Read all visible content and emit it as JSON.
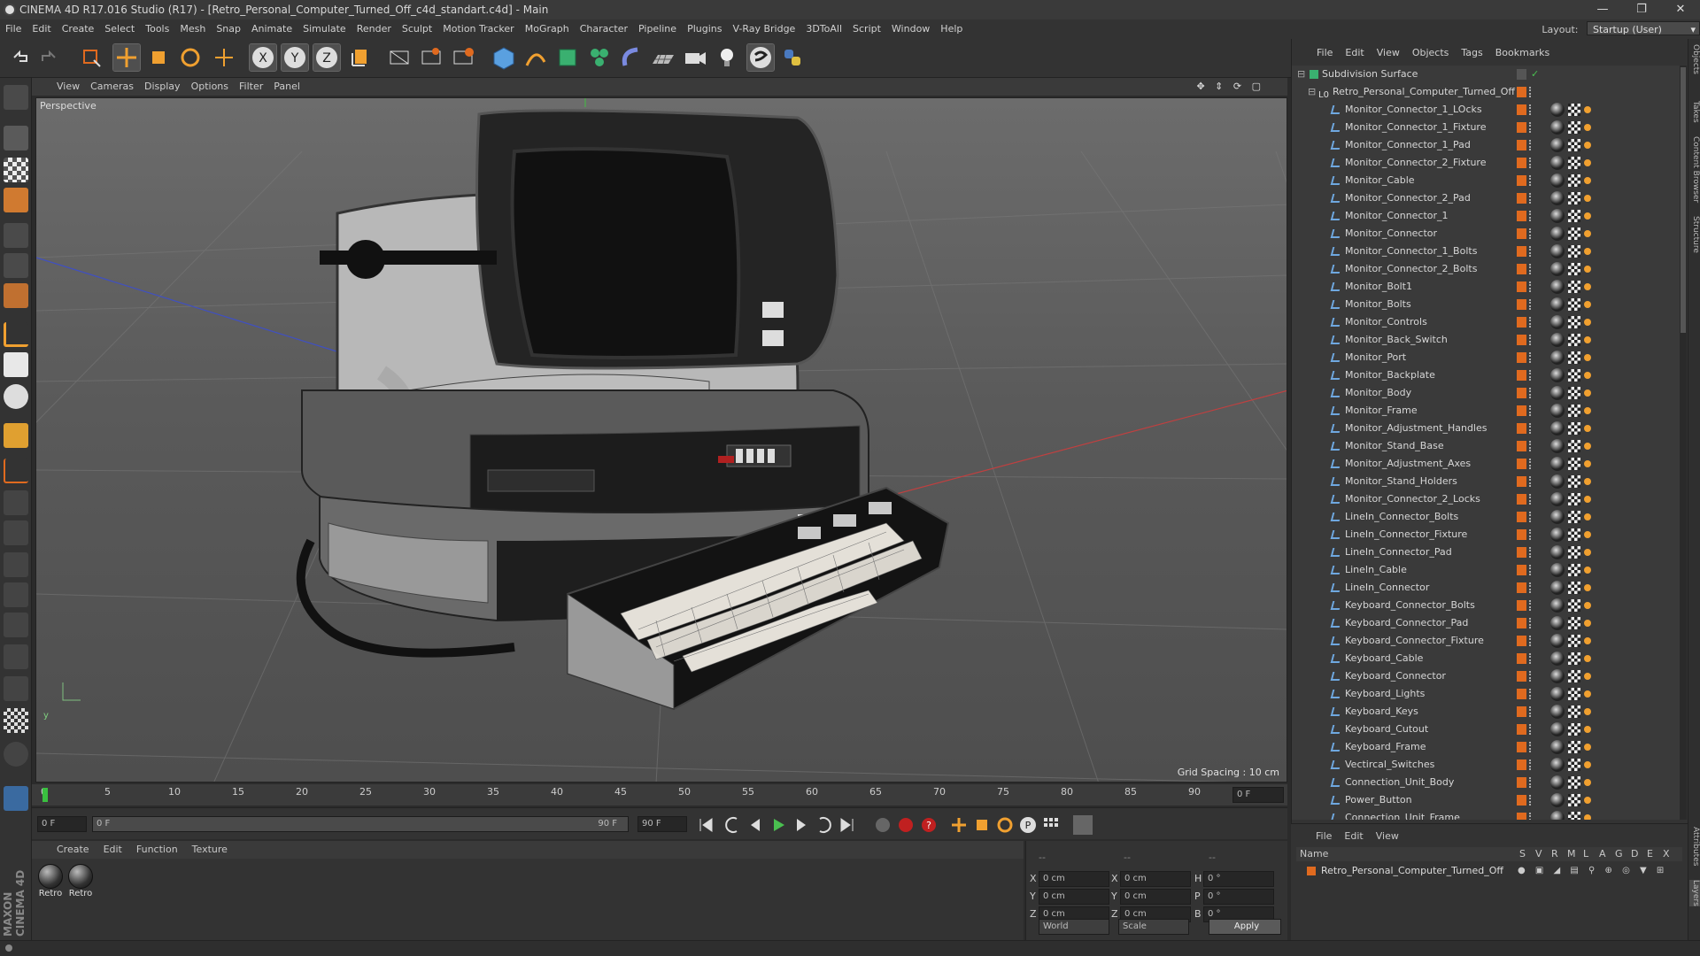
{
  "window": {
    "title": "CINEMA 4D R17.016 Studio (R17) - [Retro_Personal_Computer_Turned_Off_c4d_standart.c4d] - Main",
    "minimize": "—",
    "maximize": "❐",
    "close": "✕"
  },
  "menubar": {
    "items": [
      "File",
      "Edit",
      "Create",
      "Select",
      "Tools",
      "Mesh",
      "Snap",
      "Animate",
      "Simulate",
      "Render",
      "Sculpt",
      "Motion Tracker",
      "MoGraph",
      "Character",
      "Pipeline",
      "Plugins",
      "V-Ray Bridge",
      "3DToAll",
      "Script",
      "Window",
      "Help"
    ],
    "layout_label": "Layout:",
    "layout_value": "Startup (User)"
  },
  "viewport": {
    "menu": [
      "View",
      "Cameras",
      "Display",
      "Options",
      "Filter",
      "Panel"
    ],
    "label": "Perspective",
    "grid_spacing": "Grid Spacing : 10 cm"
  },
  "timeline": {
    "ticks": [
      "0",
      "5",
      "10",
      "15",
      "20",
      "25",
      "30",
      "35",
      "40",
      "45",
      "50",
      "55",
      "60",
      "65",
      "70",
      "75",
      "80",
      "85",
      "90"
    ],
    "frame_end_field": "0 F",
    "start_field": "0 F",
    "range_start": "0 F",
    "range_end": "90 F",
    "end_field": "90 F"
  },
  "material_manager": {
    "menu": [
      "Create",
      "Edit",
      "Function",
      "Texture"
    ],
    "materials": [
      "Retro",
      "Retro"
    ]
  },
  "coordinates": {
    "header": [
      "--",
      "--",
      "--"
    ],
    "rows": [
      {
        "a": "X",
        "av": "0 cm",
        "b": "X",
        "bv": "0 cm",
        "c": "H",
        "cv": "0 °"
      },
      {
        "a": "Y",
        "av": "0 cm",
        "b": "Y",
        "bv": "0 cm",
        "c": "P",
        "cv": "0 °"
      },
      {
        "a": "Z",
        "av": "0 cm",
        "b": "Z",
        "bv": "0 cm",
        "c": "B",
        "cv": "0 °"
      }
    ],
    "mode1": "World",
    "mode2": "Scale",
    "apply": "Apply"
  },
  "object_manager": {
    "menu": [
      "File",
      "Edit",
      "View",
      "Objects",
      "Tags",
      "Bookmarks"
    ],
    "root": "Subdivision Surface",
    "group": "Retro_Personal_Computer_Turned_Off",
    "items": [
      "Monitor_Connector_1_LOcks",
      "Monitor_Connector_1_Fixture",
      "Monitor_Connector_1_Pad",
      "Monitor_Connector_2_Fixture",
      "Monitor_Cable",
      "Monitor_Connector_2_Pad",
      "Monitor_Connector_1",
      "Monitor_Connector",
      "Monitor_Connector_1_Bolts",
      "Monitor_Connector_2_Bolts",
      "Monitor_Bolt1",
      "Monitor_Bolts",
      "Monitor_Controls",
      "Monitor_Back_Switch",
      "Monitor_Port",
      "Monitor_Backplate",
      "Monitor_Body",
      "Monitor_Frame",
      "Monitor_Adjustment_Handles",
      "Monitor_Stand_Base",
      "Monitor_Adjustment_Axes",
      "Monitor_Stand_Holders",
      "Monitor_Connector_2_Locks",
      "LineIn_Connector_Bolts",
      "LineIn_Connector_Fixture",
      "LineIn_Connector_Pad",
      "LineIn_Cable",
      "LineIn_Connector",
      "Keyboard_Connector_Bolts",
      "Keyboard_Connector_Pad",
      "Keyboard_Connector_Fixture",
      "Keyboard_Cable",
      "Keyboard_Connector",
      "Keyboard_Lights",
      "Keyboard_Keys",
      "Keyboard_Cutout",
      "Keyboard_Frame",
      "Vectircal_Switches",
      "Connection_Unit_Body",
      "Power_Button",
      "Connection_Unit_Frame"
    ]
  },
  "attribute_manager": {
    "menu": [
      "File",
      "Edit",
      "View"
    ],
    "columns": [
      "Name",
      "S",
      "V",
      "R",
      "M",
      "L",
      "A",
      "G",
      "D",
      "E",
      "X"
    ],
    "row": "Retro_Personal_Computer_Turned_Off"
  },
  "right_tabs": [
    "Objects",
    "Takes",
    "Content Browser",
    "Structure",
    "Attributes",
    "Layers"
  ],
  "branding": "MAXON CINEMA 4D",
  "colors": {
    "accent_orange": "#e06a1f",
    "axis_red": "#c04040",
    "axis_blue": "#4050c0"
  }
}
